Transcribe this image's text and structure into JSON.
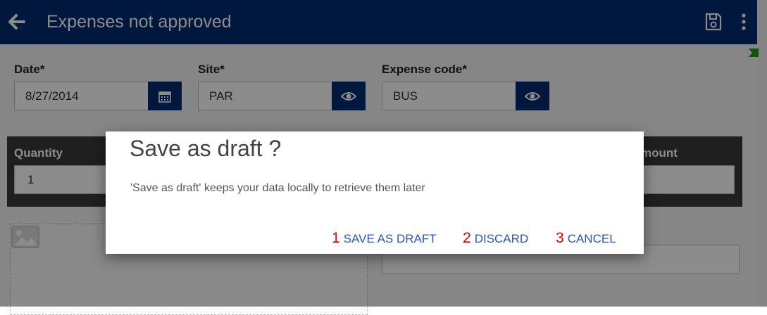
{
  "appbar": {
    "title": "Expenses not approved",
    "back_icon": "arrow-left-icon",
    "save_icon": "floppy-disk-icon",
    "more_icon": "more-vertical-icon",
    "color": "#002c6f"
  },
  "form": {
    "date": {
      "label": "Date*",
      "value": "8/27/2014",
      "button_icon": "calendar-icon"
    },
    "site": {
      "label": "Site*",
      "value": "PAR",
      "button_icon": "eye-icon"
    },
    "expense_code": {
      "label": "Expense code*",
      "value": "BUS",
      "button_icon": "eye-icon"
    },
    "quantity": {
      "label": "Quantity",
      "value": "1"
    },
    "amount": {
      "label": "Amount",
      "visible_label": "mount",
      "value": ""
    },
    "image_icon": "image-icon"
  },
  "dialog": {
    "title": "Save as draft ?",
    "message": "'Save as draft' keeps your data locally to retrieve them later",
    "actions": [
      {
        "num": "1",
        "label": "SAVE AS DRAFT"
      },
      {
        "num": "2",
        "label": "DISCARD"
      },
      {
        "num": "3",
        "label": "CANCEL"
      }
    ]
  },
  "colors": {
    "accent": "#002c6f",
    "action_text": "#2a56b8",
    "action_number": "#e00000",
    "marker": "#1a9e1a"
  }
}
